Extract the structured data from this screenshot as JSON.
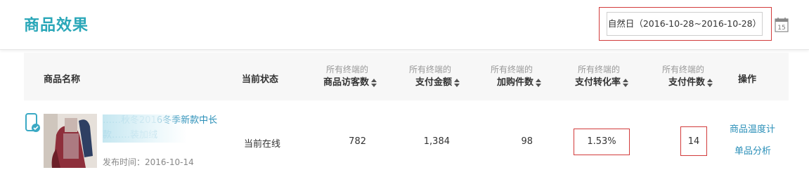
{
  "header": {
    "title": "商品效果",
    "date_range": "自然日（2016-10-28~2016-10-28）",
    "calendar_day": "15"
  },
  "table": {
    "columns": {
      "name": "商品名称",
      "status": "当前状态",
      "visitors": {
        "sub": "所有终端的",
        "main": "商品访客数"
      },
      "pay_amount": {
        "sub": "所有终端的",
        "main": "支付金额"
      },
      "cart": {
        "sub": "所有终端的",
        "main": "加购件数"
      },
      "conversion": {
        "sub": "所有终端的",
        "main": "支付转化率"
      },
      "pay_count": {
        "sub": "所有终端的",
        "main": "支付件数"
      },
      "ops": "操作"
    },
    "row": {
      "title_line1": "……秋冬2016冬季新款中长",
      "title_line2": "款……装加绒",
      "publish_date": "发布时间：2016-10-14",
      "status": "当前在线",
      "visitors": "782",
      "pay_amount": "1,384",
      "cart": "98",
      "conversion": "1.53%",
      "pay_count": "14",
      "op1": "商品温度计",
      "op2": "单品分析"
    }
  },
  "colors": {
    "accent": "#2aa7b8",
    "link": "#2a8fb8",
    "highlight": "#d23b3b"
  }
}
